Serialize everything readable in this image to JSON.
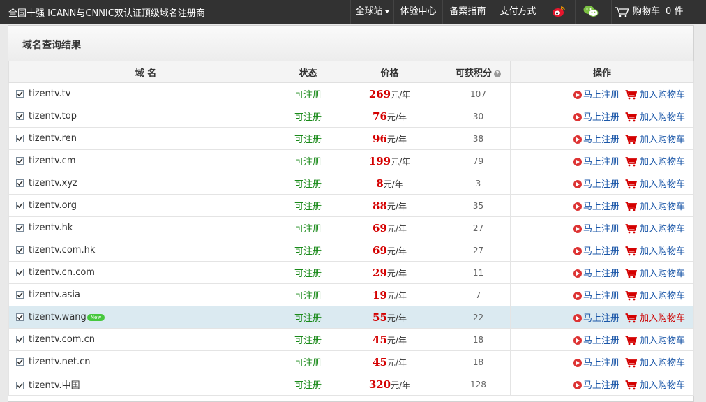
{
  "topbar": {
    "brand": "全国十强 ICANN与CNNIC双认证顶级域名注册商",
    "nav": [
      "全球站",
      "体验中心",
      "备案指南",
      "支付方式"
    ],
    "cart_label": "购物车",
    "cart_count": "0",
    "cart_unit": "件",
    "icons": [
      "weibo-icon",
      "wechat-icon",
      "cart-icon"
    ]
  },
  "panel": {
    "title": "域名查询结果"
  },
  "table": {
    "headers": {
      "domain": "域 名",
      "status": "状态",
      "price": "价格",
      "points": "可获积分",
      "ops": "操作"
    },
    "price_unit": "元/年",
    "register_label": "马上注册",
    "add_cart_label": "加入购物车",
    "new_badge": "New",
    "rows": [
      {
        "domain": "tizentv.tv",
        "status": "可注册",
        "price": "269",
        "points": "107"
      },
      {
        "domain": "tizentv.top",
        "status": "可注册",
        "price": "76",
        "points": "30"
      },
      {
        "domain": "tizentv.ren",
        "status": "可注册",
        "price": "96",
        "points": "38"
      },
      {
        "domain": "tizentv.cm",
        "status": "可注册",
        "price": "199",
        "points": "79"
      },
      {
        "domain": "tizentv.xyz",
        "status": "可注册",
        "price": "8",
        "points": "3"
      },
      {
        "domain": "tizentv.org",
        "status": "可注册",
        "price": "88",
        "points": "35"
      },
      {
        "domain": "tizentv.hk",
        "status": "可注册",
        "price": "69",
        "points": "27"
      },
      {
        "domain": "tizentv.com.hk",
        "status": "可注册",
        "price": "69",
        "points": "27"
      },
      {
        "domain": "tizentv.cn.com",
        "status": "可注册",
        "price": "29",
        "points": "11"
      },
      {
        "domain": "tizentv.asia",
        "status": "可注册",
        "price": "19",
        "points": "7"
      },
      {
        "domain": "tizentv.wang",
        "status": "可注册",
        "price": "55",
        "points": "22",
        "is_new": true,
        "highlighted": true
      },
      {
        "domain": "tizentv.com.cn",
        "status": "可注册",
        "price": "45",
        "points": "18"
      },
      {
        "domain": "tizentv.net.cn",
        "status": "可注册",
        "price": "45",
        "points": "18"
      },
      {
        "domain": "tizentv.中国",
        "status": "可注册",
        "price": "320",
        "points": "128"
      }
    ]
  },
  "colors": {
    "topbar": "#323232",
    "price": "#d40000",
    "status": "#1a8a1a",
    "link": "#1b57a8",
    "highlight_row": "#dbeaf1"
  }
}
